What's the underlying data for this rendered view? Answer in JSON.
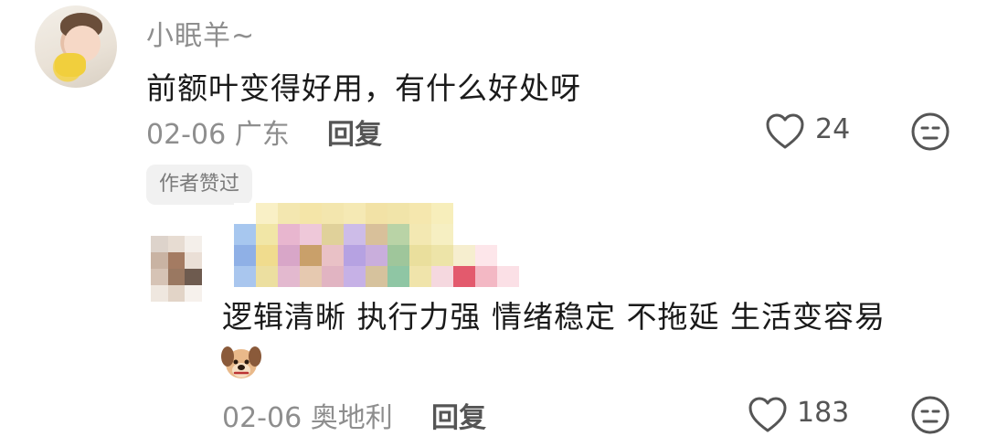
{
  "comments": [
    {
      "username": "小眠羊~",
      "content": "前额叶变得好用，有什么好处呀",
      "meta": "02-06 广东",
      "reply_label": "回复",
      "likes": "24"
    },
    {
      "author_badge": "作者赞过",
      "content": "逻辑清晰 执行力强 情绪稳定 不拖延 生活变容易",
      "meta": "02-06 奥地利",
      "reply_label": "回复",
      "likes": "183"
    }
  ],
  "colors": {
    "text_primary": "#1a1a1a",
    "text_secondary": "#8e8e8e",
    "badge_bg": "#f1f1f1"
  },
  "icons": {
    "like": "heart-outline-icon",
    "dislike": "neutral-face-icon",
    "emoji": "dog-face-emoji"
  }
}
